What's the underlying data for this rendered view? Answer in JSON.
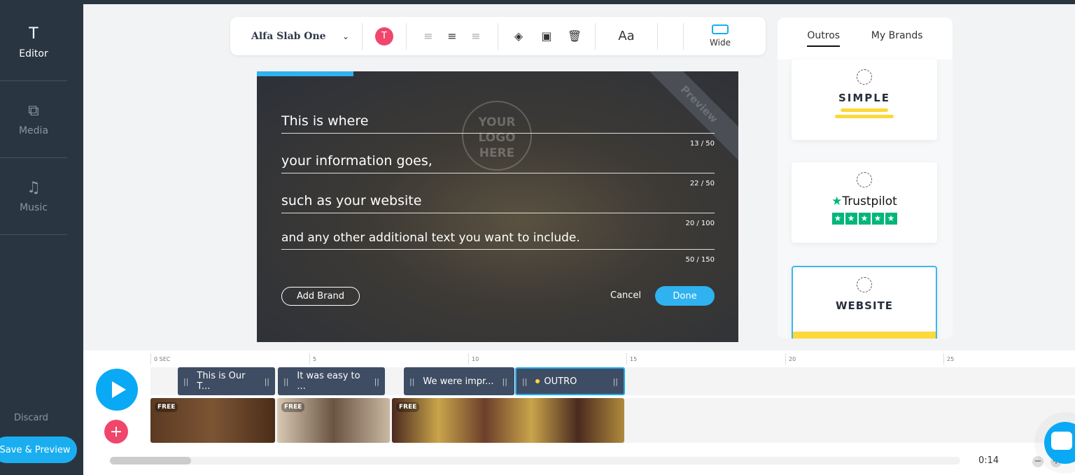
{
  "sidebar": {
    "items": [
      {
        "label": "Editor",
        "icon": "T"
      },
      {
        "label": "Media",
        "icon": "⧉"
      },
      {
        "label": "Music",
        "icon": "♫"
      }
    ],
    "discard": "Discard",
    "save_preview": "Save & Preview"
  },
  "toolbar": {
    "font": "Alfa Slab One",
    "color_letter": "T",
    "text_size": "Aa",
    "layout": "Wide"
  },
  "preview": {
    "ribbon": "Preview",
    "logo": "YOUR LOGO HERE",
    "progress": 0.2,
    "fields": [
      {
        "value": "This is where",
        "count": "13 / 50"
      },
      {
        "value": "your information goes,",
        "count": "22 / 50"
      },
      {
        "value": "such as your website",
        "count": "20 / 100"
      },
      {
        "value": "and any other additional text you want to include.",
        "count": "50 / 150"
      }
    ],
    "add_brand": "Add Brand",
    "cancel": "Cancel",
    "done": "Done"
  },
  "right_panel": {
    "tabs": [
      "Outros",
      "My Brands"
    ],
    "cards": [
      {
        "title": "SIMPLE"
      },
      {
        "title": "Trustpilot"
      },
      {
        "title": "WEBSITE"
      }
    ]
  },
  "timeline": {
    "ticks": [
      "0 SEC",
      "5",
      "10",
      "15",
      "20",
      "25"
    ],
    "text_clips": [
      "This is Our T...",
      "It was easy to ...",
      "We were impr...",
      "OUTRO"
    ],
    "media_badge": "FREE",
    "time": "0:14"
  },
  "colors": {
    "accent": "#1aaef0",
    "pink": "#f0466c",
    "sidebar": "#2a3542",
    "yellow": "#fcd83a",
    "trustpilot": "#00b67a"
  }
}
